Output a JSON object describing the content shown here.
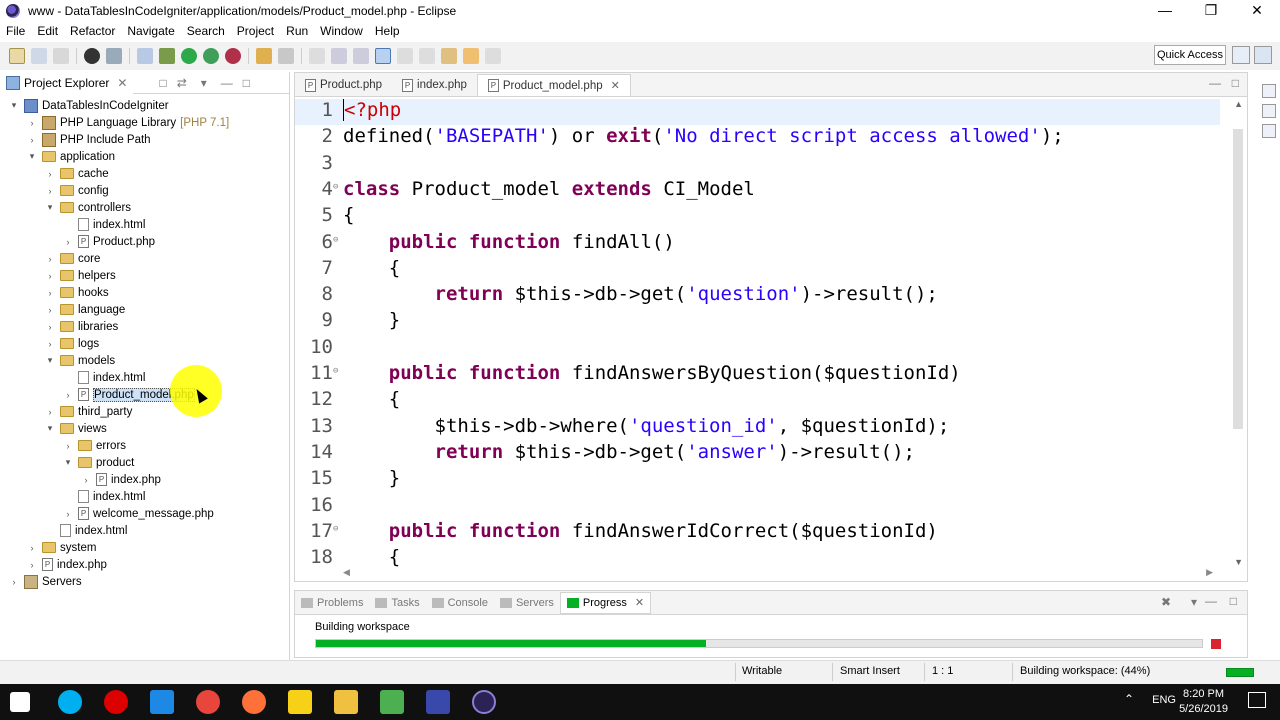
{
  "window": {
    "title": "www - DataTablesInCodeIgniter/application/models/Product_model.php - Eclipse"
  },
  "menu": [
    "File",
    "Edit",
    "Refactor",
    "Navigate",
    "Search",
    "Project",
    "Run",
    "Window",
    "Help"
  ],
  "toolbar": {
    "quick_access": "Quick Access"
  },
  "explorer": {
    "tab_label": "Project Explorer",
    "tree": [
      {
        "label": "DataTablesInCodeIgniter",
        "icon": "project",
        "depth": 0,
        "tw": "▾"
      },
      {
        "label": "PHP Language Library",
        "extra": "[PHP 7.1]",
        "icon": "library",
        "depth": 1,
        "tw": "›"
      },
      {
        "label": "PHP Include Path",
        "icon": "library",
        "depth": 1,
        "tw": "›"
      },
      {
        "label": "application",
        "icon": "folder",
        "depth": 1,
        "tw": "▾"
      },
      {
        "label": "cache",
        "icon": "folder",
        "depth": 2,
        "tw": "›"
      },
      {
        "label": "config",
        "icon": "folder",
        "depth": 2,
        "tw": "›"
      },
      {
        "label": "controllers",
        "icon": "folder",
        "depth": 2,
        "tw": "▾"
      },
      {
        "label": "index.html",
        "icon": "htmlfile",
        "depth": 3,
        "tw": ""
      },
      {
        "label": "Product.php",
        "icon": "phpfile",
        "depth": 3,
        "tw": "›"
      },
      {
        "label": "core",
        "icon": "folder",
        "depth": 2,
        "tw": "›"
      },
      {
        "label": "helpers",
        "icon": "folder",
        "depth": 2,
        "tw": "›"
      },
      {
        "label": "hooks",
        "icon": "folder",
        "depth": 2,
        "tw": "›"
      },
      {
        "label": "language",
        "icon": "folder",
        "depth": 2,
        "tw": "›"
      },
      {
        "label": "libraries",
        "icon": "folder",
        "depth": 2,
        "tw": "›"
      },
      {
        "label": "logs",
        "icon": "folder",
        "depth": 2,
        "tw": "›"
      },
      {
        "label": "models",
        "icon": "folder",
        "depth": 2,
        "tw": "▾"
      },
      {
        "label": "index.html",
        "icon": "htmlfile",
        "depth": 3,
        "tw": ""
      },
      {
        "label": "Product_model.php",
        "icon": "phpfile",
        "depth": 3,
        "tw": "›",
        "selected": true
      },
      {
        "label": "third_party",
        "icon": "folder",
        "depth": 2,
        "tw": "›"
      },
      {
        "label": "views",
        "icon": "folder",
        "depth": 2,
        "tw": "▾"
      },
      {
        "label": "errors",
        "icon": "folder",
        "depth": 3,
        "tw": "›"
      },
      {
        "label": "product",
        "icon": "folder",
        "depth": 3,
        "tw": "▾"
      },
      {
        "label": "index.php",
        "icon": "phpfile",
        "depth": 4,
        "tw": "›"
      },
      {
        "label": "index.html",
        "icon": "htmlfile",
        "depth": 3,
        "tw": ""
      },
      {
        "label": "welcome_message.php",
        "icon": "phpfile",
        "depth": 3,
        "tw": "›"
      },
      {
        "label": "index.html",
        "icon": "htmlfile",
        "depth": 2,
        "tw": ""
      },
      {
        "label": "system",
        "icon": "folder",
        "depth": 1,
        "tw": "›"
      },
      {
        "label": "index.php",
        "icon": "phpfile",
        "depth": 1,
        "tw": "›"
      },
      {
        "label": "Servers",
        "icon": "servers",
        "depth": 0,
        "tw": "›"
      }
    ]
  },
  "editor": {
    "tabs": [
      {
        "label": "Product.php",
        "active": false
      },
      {
        "label": "index.php",
        "active": false
      },
      {
        "label": "Product_model.php",
        "active": true
      }
    ],
    "lines": [
      {
        "n": "1",
        "fold": "",
        "html": "<span class=\"caret\"></span><span class=\"tag\">&lt;?php</span>"
      },
      {
        "n": "2",
        "fold": "",
        "html": "defined(<span class=\"str\">'BASEPATH'</span>) or <span class=\"kw\">exit</span>(<span class=\"str\">'No direct script access allowed'</span>);"
      },
      {
        "n": "3",
        "fold": "",
        "html": ""
      },
      {
        "n": "4",
        "fold": "⊖",
        "html": "<span class=\"kw\">class</span> Product_model <span class=\"kw\">extends</span> CI_Model"
      },
      {
        "n": "5",
        "fold": "",
        "html": "{"
      },
      {
        "n": "6",
        "fold": "⊖",
        "html": "    <span class=\"kw\">public</span> <span class=\"kw\">function</span> findAll()"
      },
      {
        "n": "7",
        "fold": "",
        "html": "    {"
      },
      {
        "n": "8",
        "fold": "",
        "html": "        <span class=\"kw\">return</span> $this-&gt;db-&gt;get(<span class=\"str\">'question'</span>)-&gt;result();"
      },
      {
        "n": "9",
        "fold": "",
        "html": "    }"
      },
      {
        "n": "10",
        "fold": "",
        "html": ""
      },
      {
        "n": "11",
        "fold": "⊖",
        "html": "    <span class=\"kw\">public</span> <span class=\"kw\">function</span> findAnswersByQuestion($questionId)"
      },
      {
        "n": "12",
        "fold": "",
        "html": "    {"
      },
      {
        "n": "13",
        "fold": "",
        "html": "        $this-&gt;db-&gt;where(<span class=\"str\">'question_id'</span>, $questionId);"
      },
      {
        "n": "14",
        "fold": "",
        "html": "        <span class=\"kw\">return</span> $this-&gt;db-&gt;get(<span class=\"str\">'answer'</span>)-&gt;result();"
      },
      {
        "n": "15",
        "fold": "",
        "html": "    }"
      },
      {
        "n": "16",
        "fold": "",
        "html": ""
      },
      {
        "n": "17",
        "fold": "⊖",
        "html": "    <span class=\"kw\">public</span> <span class=\"kw\">function</span> findAnswerIdCorrect($questionId)"
      },
      {
        "n": "18",
        "fold": "",
        "html": "    {"
      }
    ]
  },
  "bottom": {
    "tabs": [
      {
        "label": "Problems",
        "active": false
      },
      {
        "label": "Tasks",
        "active": false
      },
      {
        "label": "Console",
        "active": false
      },
      {
        "label": "Servers",
        "active": false
      },
      {
        "label": "Progress",
        "active": true
      }
    ],
    "progress_label": "Building workspace",
    "progress_value": 0.44
  },
  "status": {
    "writable": "Writable",
    "insert_mode": "Smart Insert",
    "position": "1 : 1",
    "task": "Building workspace: (44%)"
  },
  "taskbar": {
    "lang": "ENG",
    "time": "8:20 PM",
    "date": "5/26/2019"
  },
  "colors": {
    "keyword": "#7f0055",
    "string": "#2a00ff",
    "php_tag": "#cc0000",
    "progress": "#06b025",
    "selection": "#cde1f7"
  }
}
